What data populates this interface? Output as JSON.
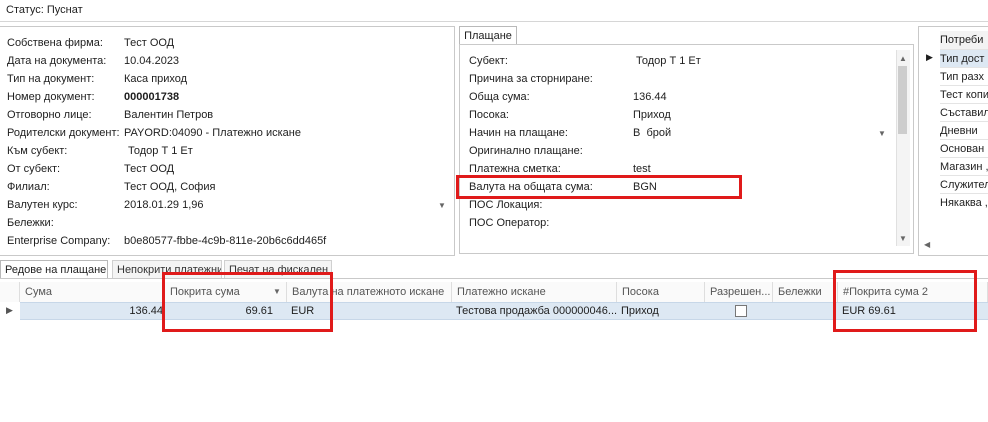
{
  "status": "Статус: Пуснат",
  "details": {
    "rows": [
      {
        "label": "Собствена фирма:",
        "value": "Тест ООД"
      },
      {
        "label": "Дата на документа:",
        "value": "10.04.2023"
      },
      {
        "label": "Тип на документ:",
        "value": "Каса приход"
      },
      {
        "label": "Номер документ:",
        "value": "000001738"
      },
      {
        "label": "Отговорно лице:",
        "value": "Валентин Петров"
      },
      {
        "label": "Родителски документ:",
        "value": "PAYORD:04090 - Платежно искане"
      },
      {
        "label": "Към субект:",
        "value": "Тодор Т 1 Ет"
      },
      {
        "label": "От субект:",
        "value": "Тест ООД"
      },
      {
        "label": "Филиал:",
        "value": "Тест ООД, София"
      },
      {
        "label": "Валутен курс:",
        "value": "2018.01.29 1,96"
      },
      {
        "label": "Бележки:",
        "value": ""
      },
      {
        "label": "Enterprise Company:",
        "value": "b0e80577-fbbe-4c9b-811e-20b6c6dd465f"
      }
    ]
  },
  "payment": {
    "tab": "Плащане",
    "rows": [
      {
        "label": "Субект:",
        "value": "Тодор Т 1 Ет"
      },
      {
        "label": "Причина за сторниране:",
        "value": ""
      },
      {
        "label": "Обща сума:",
        "value": "136.44"
      },
      {
        "label": "Посока:",
        "value": "Приход"
      },
      {
        "label": "Начин на плащане:",
        "value": "В  брой"
      },
      {
        "label": "Оригинално плащане:",
        "value": ""
      },
      {
        "label": "Платежна сметка:",
        "value": "test"
      },
      {
        "label": "Валута на общата сума:",
        "value": "BGN"
      },
      {
        "label": "ПОС Локация:",
        "value": ""
      },
      {
        "label": "ПОС Оператор:",
        "value": ""
      }
    ]
  },
  "consumers": {
    "header": "Потреби",
    "items": [
      "Тип дост",
      "Тип разх",
      "Тест копи",
      "Съставил",
      "Дневни",
      "Основан",
      "Магазин ,",
      "Служител",
      "Някаква ,"
    ]
  },
  "bottom_tabs": [
    "Редове на плащане",
    "Непокрити платежни",
    "Печат на фискален"
  ],
  "grid": {
    "columns": [
      "Сума",
      "Покрита сума",
      "Валута на платежното искане",
      "Платежно искане",
      "Посока",
      "Разрешен...",
      "Бележки",
      "#Покрита сума 2"
    ],
    "row": {
      "amount": "136.44",
      "covered": "69.61",
      "currency": "EUR",
      "request": "Тестова продажба 000000046...",
      "direction": "Приход",
      "allowed": false,
      "notes": "",
      "covered2": "EUR 69.61"
    }
  },
  "colors": {
    "highlight": "#e01a1a",
    "selected_row": "#dde8f3"
  }
}
